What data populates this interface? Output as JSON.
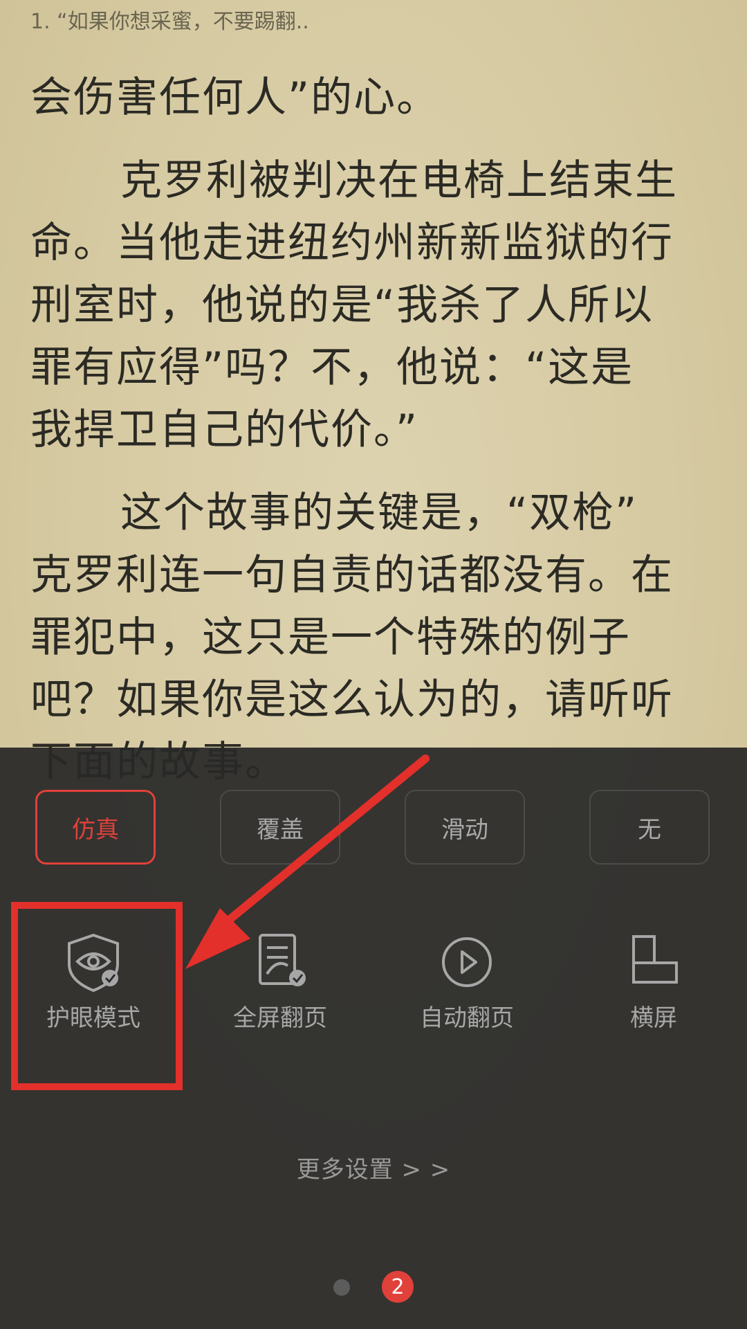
{
  "reader": {
    "chapter_header": "1. “如果你想采蜜，不要踢翻..",
    "lines": [
      "会伤害任何人”的心。",
      "克罗利被判决在电椅上结束生",
      "命。当他走进纽约州新新监狱的行",
      "刑室时，他说的是“我杀了人所以",
      "罪有应得”吗？不，他说：“这是",
      "我捍卫自己的代价。”",
      "这个故事的关键是，“双枪”",
      "克罗利连一句自责的话都没有。在",
      "罪犯中，这只是一个特殊的例子",
      "吧？如果你是这么认为的，请听听",
      "下面的故事。"
    ],
    "ghost_lines": [
      "",
      "",
      "",
      "",
      "",
      ""
    ]
  },
  "page_turn_modes": [
    {
      "label": "仿真",
      "active": true
    },
    {
      "label": "覆盖",
      "active": false
    },
    {
      "label": "滑动",
      "active": false
    },
    {
      "label": "无",
      "active": false
    }
  ],
  "tools": [
    {
      "label": "护眼模式",
      "icon": "eye-shield-icon"
    },
    {
      "label": "全屏翻页",
      "icon": "fullscreen-page-icon"
    },
    {
      "label": "自动翻页",
      "icon": "play-circle-icon"
    },
    {
      "label": "横屏",
      "icon": "landscape-icon"
    }
  ],
  "more_settings": "更多设置 > >",
  "pager": {
    "current_page": "2"
  },
  "colors": {
    "accent": "#e0413a",
    "highlight": "#e3302b"
  }
}
